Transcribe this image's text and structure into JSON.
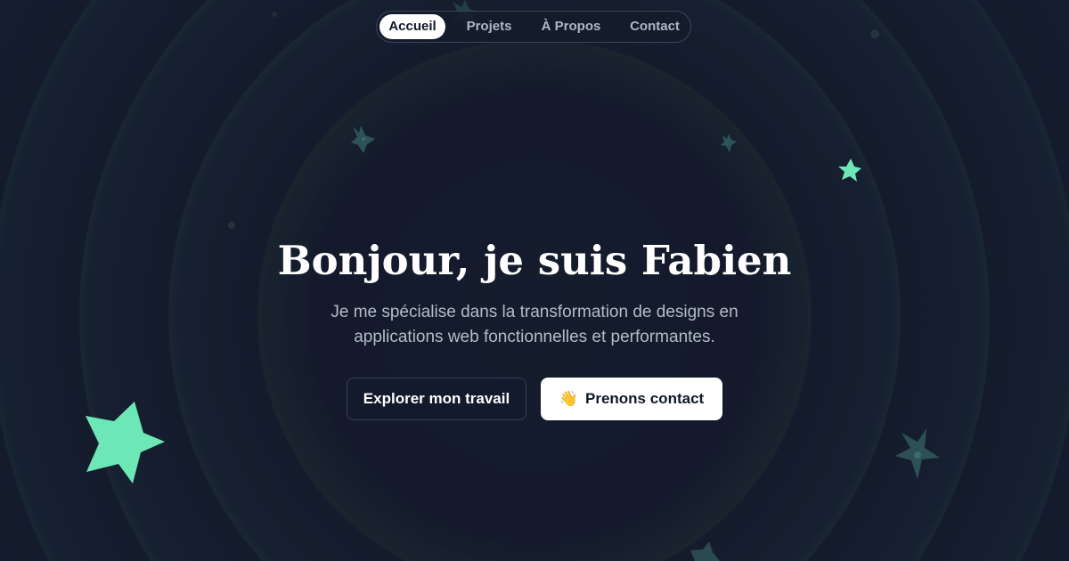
{
  "nav": {
    "items": [
      {
        "label": "Accueil",
        "active": true
      },
      {
        "label": "Projets",
        "active": false
      },
      {
        "label": "À Propos",
        "active": false
      },
      {
        "label": "Contact",
        "active": false
      }
    ]
  },
  "hero": {
    "title": "Bonjour, je suis Fabien",
    "subtitle_line1": "Je me spécialise dans la transformation de designs en",
    "subtitle_line2": "applications web fonctionnelles et performantes.",
    "primary_cta": "Explorer mon travail",
    "secondary_cta_icon": "waving-hand-icon",
    "secondary_cta_emoji": "👋",
    "secondary_cta": "Prenons contact"
  },
  "colors": {
    "background": "#131a2b",
    "accent": "#5eead4",
    "star_bright": "#6ee7b7",
    "star_dim": "#2a4f54",
    "nav_active_bg": "#ffffff",
    "text_muted": "#b3bbc8"
  }
}
